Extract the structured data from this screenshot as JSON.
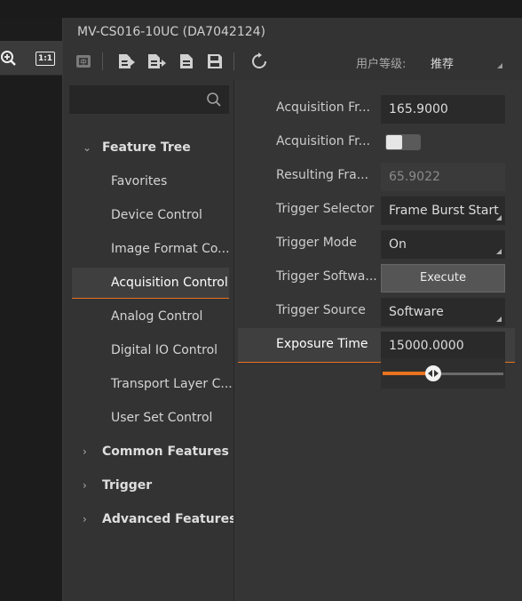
{
  "window": {
    "title": "MV-CS016-10UC (DA7042124)"
  },
  "image_view": {
    "one_to_one_label": "1:1"
  },
  "toolbar": {
    "buttons": [
      "feature-tree-icon",
      "import-features-icon",
      "export-features-icon",
      "document-icon",
      "save-icon",
      "refresh-icon"
    ],
    "user_level_label": "用户等级:",
    "user_level_value": "推荐"
  },
  "search": {
    "placeholder": ""
  },
  "tree": {
    "root": {
      "label": "Feature Tree",
      "expanded": true
    },
    "children": [
      {
        "label": "Favorites"
      },
      {
        "label": "Device Control"
      },
      {
        "label": "Image Format Co..."
      },
      {
        "label": "Acquisition Control",
        "selected": true
      },
      {
        "label": "Analog Control"
      },
      {
        "label": "Digital IO Control"
      },
      {
        "label": "Transport Layer C..."
      },
      {
        "label": "User Set Control"
      }
    ],
    "groups": [
      {
        "label": "Common Features"
      },
      {
        "label": "Trigger"
      },
      {
        "label": "Advanced Features"
      }
    ]
  },
  "properties": [
    {
      "name": "Acquisition Fr...",
      "value": "165.9000",
      "kind": "input"
    },
    {
      "name": "Acquisition Fr...",
      "value": "",
      "kind": "toggle",
      "on": false
    },
    {
      "name": "Resulting Fra...",
      "value": "65.9022",
      "kind": "readonly"
    },
    {
      "name": "Trigger Selector",
      "value": "Frame Burst Start",
      "kind": "select"
    },
    {
      "name": "Trigger Mode",
      "value": "On",
      "kind": "select"
    },
    {
      "name": "Trigger Softwa...",
      "value": "Execute",
      "kind": "button"
    },
    {
      "name": "Trigger Source",
      "value": "Software",
      "kind": "select"
    },
    {
      "name": "Exposure Time",
      "value": "15000.0000",
      "kind": "input",
      "selected": true
    }
  ],
  "exposure_slider": {
    "fraction": 0.42
  },
  "colors": {
    "accent": "#e8731e",
    "background": "#333333",
    "field": "#2a2a2a"
  }
}
